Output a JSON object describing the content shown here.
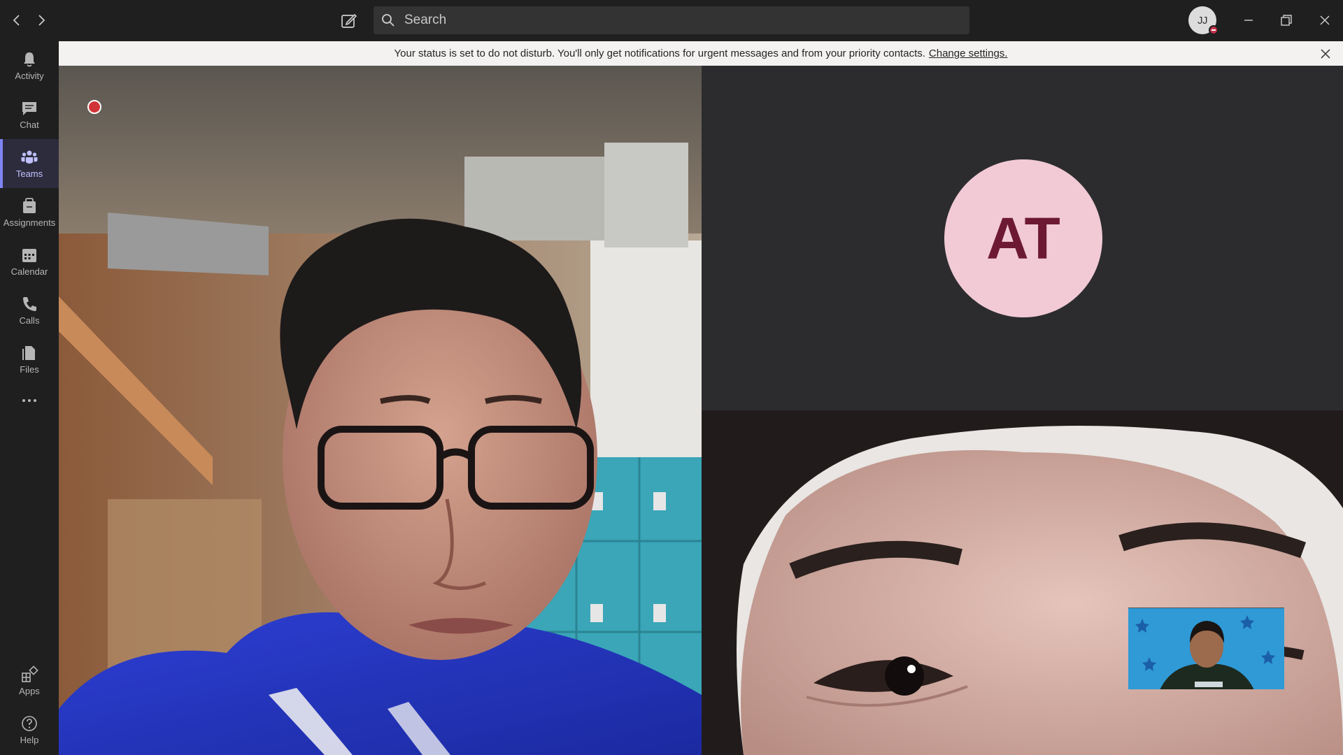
{
  "titlebar": {
    "search_placeholder": "Search",
    "user_initials": "JJ",
    "presence": "do-not-disturb"
  },
  "rail": {
    "items": [
      {
        "label": "Activity",
        "icon": "bell-icon"
      },
      {
        "label": "Chat",
        "icon": "chat-icon"
      },
      {
        "label": "Teams",
        "icon": "teams-icon"
      },
      {
        "label": "Assignments",
        "icon": "assignments-icon"
      },
      {
        "label": "Calendar",
        "icon": "calendar-icon"
      },
      {
        "label": "Calls",
        "icon": "phone-icon"
      },
      {
        "label": "Files",
        "icon": "files-icon"
      },
      {
        "label": "Apps",
        "icon": "apps-icon"
      },
      {
        "label": "Help",
        "icon": "help-icon"
      }
    ],
    "active": "Teams"
  },
  "banner": {
    "message": "Your status is set to do not disturb. You'll only get notifications for urgent messages and from your priority contacts.",
    "link": "Change settings."
  },
  "call": {
    "participant_initials": "AT",
    "recording": true
  },
  "colors": {
    "accent": "#7f85f5",
    "dnd_red": "#c4314b",
    "avatar_bg": "#f1cad5",
    "avatar_text": "#6d1934"
  }
}
